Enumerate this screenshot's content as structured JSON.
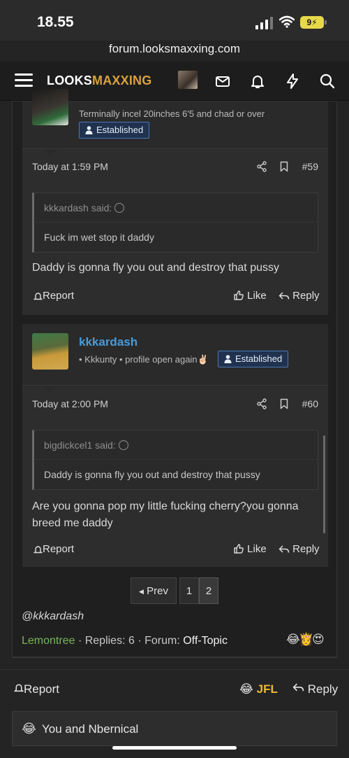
{
  "status_bar": {
    "time": "18.55",
    "battery": "9"
  },
  "browser": {
    "url": "forum.looksmaxxing.com"
  },
  "navbar": {
    "logo_part1": "LOOKS",
    "logo_part2": "MAXXING"
  },
  "post_59": {
    "poster_title": "Terminally incel 20inches 6'5 and chad or over",
    "badge": "Established",
    "time": "Today at 1:59 PM",
    "number": "#59",
    "quote_author": "kkkardash said:",
    "quote_text": "Fuck im wet stop it daddy",
    "text": "Daddy is gonna fly you out and destroy that pussy",
    "report_label": "Report",
    "like_label": "Like",
    "reply_label": "Reply"
  },
  "post_60": {
    "poster_name": "kkkardash",
    "poster_title": "• Kkkunty • profile open again✌🏻",
    "badge": "Established",
    "time": "Today at 2:00 PM",
    "number": "#60",
    "quote_author": "bigdickcel1 said:",
    "quote_text": "Daddy is gonna fly you out and destroy that pussy",
    "text": "Are you gonna pop my little fucking cherry?you gonna breed me daddy",
    "report_label": "Report",
    "like_label": "Like",
    "reply_label": "Reply"
  },
  "pagination": {
    "prev_label": "Prev",
    "pages": [
      "1",
      "2"
    ],
    "current_page": "2"
  },
  "thread_card": {
    "mention": "@kkkardash",
    "author": "Lemontree",
    "replies_label": "Replies:",
    "replies": "6",
    "forum_label": "Forum:",
    "forum": "Off-Topic",
    "reaction_emojis": [
      "😂",
      "👸",
      "😍"
    ]
  },
  "bottom_actions": {
    "report_label": "Report",
    "jfl_emoji": "😂",
    "jfl_label": "JFL",
    "reply_label": "Reply"
  },
  "reactions_summary": {
    "emoji": "😂",
    "text": "You and Nbernical"
  }
}
